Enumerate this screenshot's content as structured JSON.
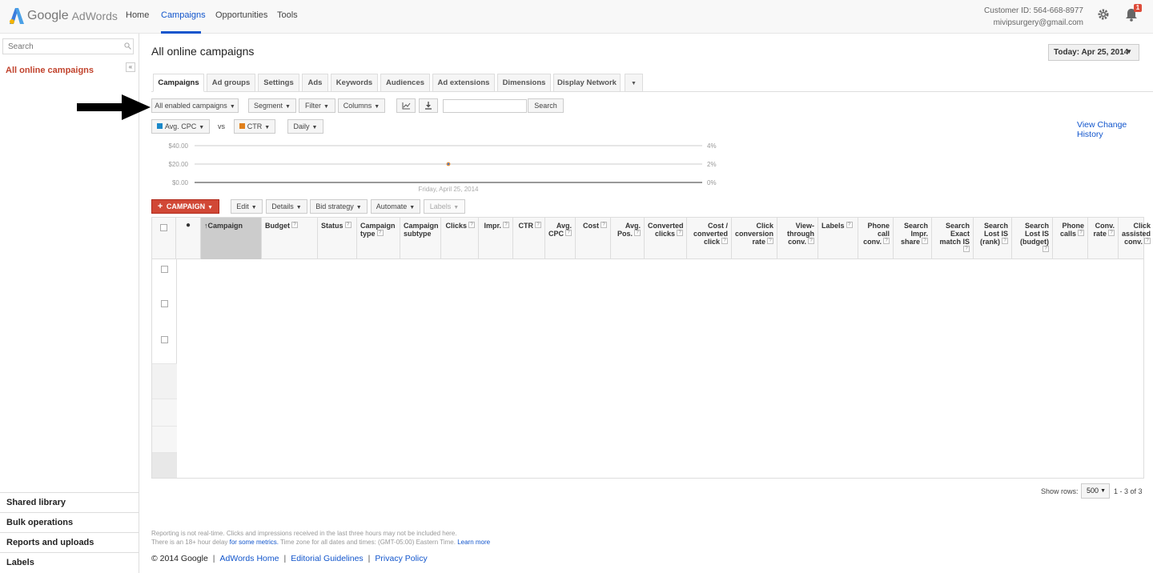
{
  "app": {
    "brand_google": "Google",
    "brand_product": "AdWords"
  },
  "nav": {
    "home": "Home",
    "campaigns": "Campaigns",
    "opportunities": "Opportunities",
    "tools": "Tools"
  },
  "account": {
    "customer_id": "Customer ID: 564-668-8977",
    "email": "mivipsurgery@gmail.com",
    "notification_count": "1"
  },
  "sidebar": {
    "search_placeholder": "Search",
    "collapse": "«",
    "selected": "All online campaigns",
    "bottom_items": [
      "Shared library",
      "Bulk operations",
      "Reports and uploads",
      "Labels"
    ]
  },
  "header": {
    "title": "All online campaigns",
    "date_range": "Today: Apr 25, 2014"
  },
  "tabs": [
    "Campaigns",
    "Ad groups",
    "Settings",
    "Ads",
    "Keywords",
    "Audiences",
    "Ad extensions",
    "Dimensions",
    "Display Network"
  ],
  "toolbar": {
    "filter_scope": "All enabled campaigns",
    "segment": "Segment",
    "filter": "Filter",
    "columns": "Columns",
    "search_button": "Search"
  },
  "chart_controls": {
    "metric1": "Avg. CPC",
    "vs": "vs",
    "metric2": "CTR",
    "granularity": "Daily",
    "view_change_history": "View Change History"
  },
  "chart_data": {
    "type": "line",
    "x": [
      "Friday, April 25, 2014"
    ],
    "series": [
      {
        "name": "Avg. CPC",
        "values": [
          0
        ],
        "color": "#3c78d8"
      },
      {
        "name": "CTR",
        "values": [
          0
        ],
        "color": "#e69138"
      }
    ],
    "y_left_ticks": [
      "$40.00",
      "$20.00",
      "$0.00"
    ],
    "y_right_ticks": [
      "4%",
      "2%",
      "0%"
    ],
    "point_label_value": 20,
    "ylim_left": [
      0,
      40
    ],
    "ylim_right": [
      0,
      4
    ]
  },
  "actions": {
    "campaign": "CAMPAIGN",
    "edit": "Edit",
    "details": "Details",
    "bid_strategy": "Bid strategy",
    "automate": "Automate",
    "labels": "Labels"
  },
  "table": {
    "columns": [
      {
        "label": "Campaign",
        "help": false
      },
      {
        "label": "Budget",
        "help": true
      },
      {
        "label": "Status",
        "help": true
      },
      {
        "label": "Campaign type",
        "help": true
      },
      {
        "label": "Campaign subtype",
        "help": false
      },
      {
        "label": "Clicks",
        "help": true
      },
      {
        "label": "Impr.",
        "help": true
      },
      {
        "label": "CTR",
        "help": true
      },
      {
        "label": "Avg. CPC",
        "help": true
      },
      {
        "label": "Cost",
        "help": true
      },
      {
        "label": "Avg. Pos.",
        "help": true
      },
      {
        "label": "Converted clicks",
        "help": true
      },
      {
        "label": "Cost / converted click",
        "help": true
      },
      {
        "label": "Click conversion rate",
        "help": true
      },
      {
        "label": "View-through conv.",
        "help": true
      },
      {
        "label": "Labels",
        "help": true
      },
      {
        "label": "Phone call conv.",
        "help": true
      },
      {
        "label": "Search Impr. share",
        "help": true
      },
      {
        "label": "Search Exact match IS",
        "help": true
      },
      {
        "label": "Search Lost IS (rank)",
        "help": true
      },
      {
        "label": "Search Lost IS (budget)",
        "help": true
      },
      {
        "label": "Phone calls",
        "help": true
      },
      {
        "label": "Conv. rate",
        "help": true
      },
      {
        "label": "Click assisted conv.",
        "help": true
      }
    ],
    "show_rows_label": "Show rows:",
    "show_rows_value": "500",
    "range": "1 - 3 of 3"
  },
  "footer": {
    "note1": "Reporting is not real-time. Clicks and impressions received in the last three hours may not be included here.",
    "note2_pre": "There is an 18+ hour delay ",
    "note2_link": "for some metrics.",
    "note2_post": " Time zone for all dates and times: (GMT-05:00) Eastern Time.",
    "learn_more": "Learn more",
    "copyright": "© 2014 Google",
    "links": [
      "AdWords Home",
      "Editorial Guidelines",
      "Privacy Policy"
    ]
  }
}
